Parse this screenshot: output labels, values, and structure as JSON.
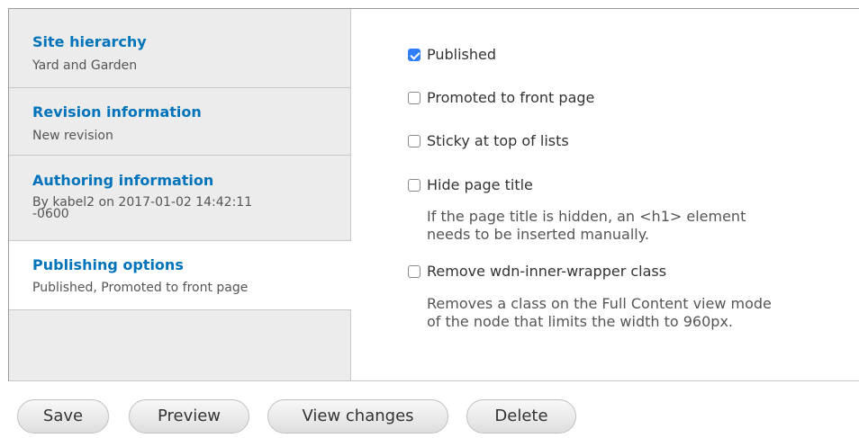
{
  "sidebar": {
    "tabs": [
      {
        "title": "Site hierarchy",
        "summary": "Yard and Garden"
      },
      {
        "title": "Revision information",
        "summary": "New revision"
      },
      {
        "title": "Authoring information",
        "summary_line1": "By kabel2 on 2017-01-02 14:42:11",
        "summary_line2": "-0600"
      },
      {
        "title": "Publishing options",
        "summary": "Published, Promoted to front page"
      }
    ]
  },
  "publishing": {
    "options": [
      {
        "label": "Published",
        "checked": true
      },
      {
        "label": "Promoted to front page",
        "checked": false
      },
      {
        "label": "Sticky at top of lists",
        "checked": false
      },
      {
        "label": "Hide page title",
        "checked": false,
        "desc_line1": "If the page title is hidden, an <h1> element",
        "desc_line2": "needs to be inserted manually."
      },
      {
        "label": "Remove wdn-inner-wrapper class",
        "checked": false,
        "desc_line1": "Removes a class on the Full Content view mode",
        "desc_line2": "of the node that limits the width to 960px."
      }
    ]
  },
  "actions": {
    "save": "Save",
    "preview": "Preview",
    "view_changes": "View changes",
    "delete": "Delete"
  },
  "colors": {
    "link": "#0073ba",
    "checkbox_checked": "#2f7ef7",
    "sidebar_bg": "#ececec"
  }
}
